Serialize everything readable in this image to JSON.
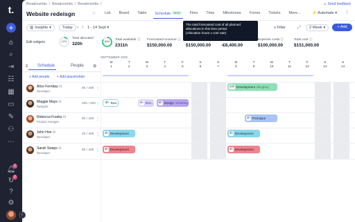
{
  "rail": {
    "logo": "t.",
    "add": "+",
    "icons": [
      "home-icon",
      "search-icon",
      "collapse-icon",
      "schedule-icon",
      "calendar-icon",
      "folder-icon",
      "pencil-icon",
      "people-icon",
      "more-icon",
      "bell-icon",
      "refresh-icon",
      "help-icon",
      "gear-icon"
    ],
    "badges": [
      "1",
      "2"
    ],
    "collapse": "›"
  },
  "breadcrumbs": [
    "Breadcrumbs",
    "/",
    "Breadcrumbs",
    "/",
    "Breadcrumbs",
    "/"
  ],
  "feedback": "Send feedback",
  "project": {
    "title": "Website redeisgn",
    "star": "☆"
  },
  "tabs": [
    {
      "label": "List"
    },
    {
      "label": "Board"
    },
    {
      "label": "Table"
    },
    {
      "label": "Schedule",
      "badge": "NEW",
      "active": true
    },
    {
      "label": "Files"
    },
    {
      "label": "Time"
    },
    {
      "label": "Milestones"
    },
    {
      "label": "Forms"
    },
    {
      "label": "Tickets"
    },
    {
      "label": "More..."
    }
  ],
  "automate": "Automate",
  "toolbar": {
    "insights": "Insights",
    "today": "Today",
    "range": "1 - 14 Sept",
    "filter": "Filter",
    "zoom": "2 Week",
    "add": "+ Add"
  },
  "tooltip": {
    "lines": [
      "The total forecasted cost of all planned",
      "allocations in this time period.",
      "(Allocation hours x cost rate)"
    ]
  },
  "stats": {
    "edit_widgets": "Edit widgets",
    "ring_a": "12%",
    "ring_b": "84%",
    "items": [
      {
        "label": "Total allocated",
        "value": "320h"
      },
      {
        "label": "Total available",
        "value": "2311h"
      },
      {
        "label": "Forecasted revenue",
        "value": "$150,000.00"
      },
      {
        "label": "Forecasted cost",
        "value": "$150,000.00"
      },
      {
        "label": "Forecasted profit",
        "value": "-€8,400.00"
      },
      {
        "label": "Expense costs",
        "value": "$100,000.00"
      },
      {
        "label": "Total cost",
        "value": "$151,000.00"
      }
    ]
  },
  "schedule": {
    "month": "SEPTEMBER 2025",
    "subtabs": [
      "Schedule",
      "People"
    ],
    "add_people": "+ Add people",
    "add_placeholder": "+ Add placeholder",
    "days": [
      {
        "dow": "M",
        "num": "1"
      },
      {
        "dow": "T",
        "num": "2"
      },
      {
        "dow": "W",
        "num": "3"
      },
      {
        "dow": "T",
        "num": "4"
      },
      {
        "dow": "F",
        "num": "5"
      },
      {
        "dow": "S",
        "num": "6"
      },
      {
        "dow": "S",
        "num": "7"
      },
      {
        "dow": "M",
        "num": "8"
      },
      {
        "dow": "T",
        "num": "9"
      },
      {
        "dow": "W",
        "num": "10"
      },
      {
        "dow": "T",
        "num": "11"
      },
      {
        "dow": "F",
        "num": "12"
      },
      {
        "dow": "S",
        "num": "13"
      },
      {
        "dow": "S",
        "num": "14"
      }
    ],
    "people": [
      {
        "name": "Alice Ferriday",
        "role": "Developer",
        "hours": "0h / 40h"
      },
      {
        "name": "Maggie Mays",
        "role": "Designer",
        "hours": "20h / 40h"
      },
      {
        "name": "Rebecca Franks",
        "role": "Product manager",
        "hours": "8h / 40h"
      },
      {
        "name": "John Hon",
        "role": "Developer",
        "hours": "4h / 40h"
      },
      {
        "name": "Sarah Swaps",
        "role": "Developer",
        "hours": "8h / 40h"
      }
    ],
    "bars": [
      {
        "hrs": "24h",
        "label": "Development",
        "note": "Blingbay",
        "color": "green"
      },
      {
        "hrs": "8h",
        "label": "Res...",
        "color": "outline"
      },
      {
        "hrs": "8h",
        "label": "Res...",
        "color": "lavender"
      },
      {
        "hrs": "8h",
        "label": "Design",
        "note": "Whilebay",
        "color": "purple"
      },
      {
        "hrs": "4h",
        "label": "Prototype",
        "color": "blue"
      },
      {
        "hrs": "4h",
        "label": "Development",
        "color": "teal"
      },
      {
        "hrs": "4h",
        "label": "Development",
        "color": "teal"
      },
      {
        "hrs": "4h",
        "label": "Development",
        "color": "red"
      },
      {
        "hrs": "4h",
        "label": "Development",
        "color": "red"
      }
    ]
  }
}
